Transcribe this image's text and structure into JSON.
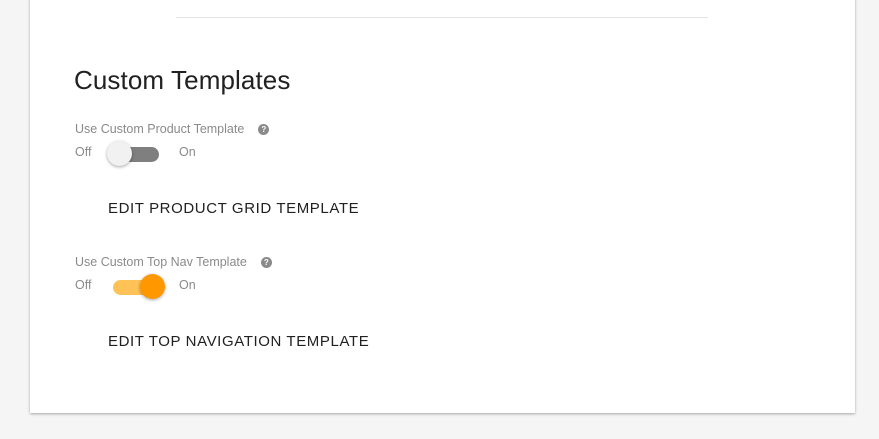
{
  "section": {
    "title": "Custom Templates"
  },
  "settings": [
    {
      "label": "Use Custom Product Template",
      "help_icon": "question-circle-icon",
      "help_glyph": "?",
      "off_label": "Off",
      "on_label": "On",
      "enabled": false,
      "button_label": "EDIT PRODUCT GRID TEMPLATE"
    },
    {
      "label": "Use Custom Top Nav Template",
      "help_icon": "question-circle-icon",
      "help_glyph": "?",
      "off_label": "Off",
      "on_label": "On",
      "enabled": true,
      "button_label": "EDIT TOP NAVIGATION TEMPLATE"
    }
  ],
  "colors": {
    "toggle_on_thumb": "#ff9800",
    "toggle_on_track": "#ffc257",
    "toggle_off_thumb": "#f1f1f1",
    "toggle_off_track": "#7f7f7f"
  }
}
